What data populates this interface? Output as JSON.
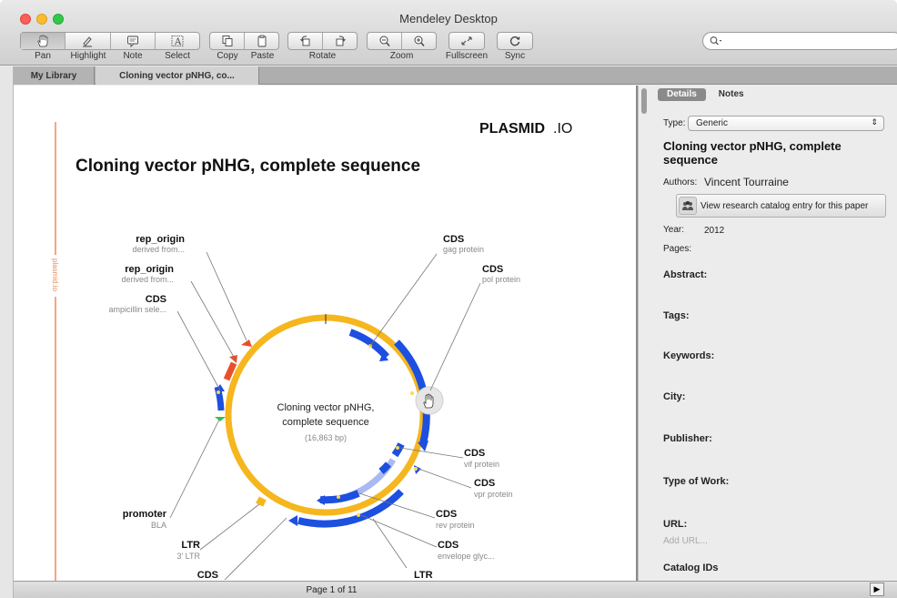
{
  "window": {
    "title": "Mendeley Desktop"
  },
  "toolbar": {
    "groups": [
      {
        "label": "Pan"
      },
      {
        "label": "Highlight"
      },
      {
        "label": "Note"
      },
      {
        "label": "Select"
      },
      {
        "label": "Copy"
      },
      {
        "label": "Paste"
      },
      {
        "label": "Rotate"
      },
      {
        "label": "Zoom"
      },
      {
        "label": "Fullscreen"
      },
      {
        "label": "Sync"
      }
    ]
  },
  "tabs": [
    {
      "label": "My Library"
    },
    {
      "label": "Cloning vector pNHG, co..."
    }
  ],
  "document": {
    "brand_bold": "PLASMID",
    "brand_light": ".IO",
    "side_label": "plasmid.io",
    "title": "Cloning vector pNHG, complete sequence",
    "center_title_1": "Cloning vector pNHG,",
    "center_title_2": "complete sequence",
    "center_size": "(16,863 bp)",
    "features": [
      {
        "name": "rep_origin",
        "sub": "derived from..."
      },
      {
        "name": "rep_origin",
        "sub": "derived from..."
      },
      {
        "name": "CDS",
        "sub": "ampicillin sele..."
      },
      {
        "name": "CDS",
        "sub": "gag protein"
      },
      {
        "name": "CDS",
        "sub": "pol protein"
      },
      {
        "name": "CDS",
        "sub": "vif protein"
      },
      {
        "name": "CDS",
        "sub": "vpr protein"
      },
      {
        "name": "CDS",
        "sub": "rev protein"
      },
      {
        "name": "CDS",
        "sub": "envelope glyc..."
      },
      {
        "name": "promoter",
        "sub": "BLA"
      },
      {
        "name": "LTR",
        "sub": "3' LTR"
      },
      {
        "name": "CDS",
        "sub": ""
      },
      {
        "name": "LTR",
        "sub": ""
      }
    ]
  },
  "details": {
    "tabs": [
      "Details",
      "Notes"
    ],
    "type_label": "Type:",
    "type_value": "Generic",
    "title": "Cloning vector pNHG, complete sequence",
    "authors_label": "Authors:",
    "authors_value": "Vincent Tourraine",
    "catalog_button": "View research catalog entry for this paper",
    "year_label": "Year:",
    "year_value": "2012",
    "pages_label": "Pages:",
    "abstract": "Abstract:",
    "tags": "Tags:",
    "keywords": "Keywords:",
    "city": "City:",
    "publisher": "Publisher:",
    "type_of_work": "Type of Work:",
    "url": "URL:",
    "url_placeholder": "Add URL...",
    "catalog_ids": "Catalog IDs"
  },
  "status": {
    "page": "Page 1 of 11"
  },
  "colors": {
    "backbone": "#f5b61e",
    "feature_blue": "#1d4fe0",
    "feature_red": "#e9502a",
    "accent_line": "#f08a55"
  }
}
